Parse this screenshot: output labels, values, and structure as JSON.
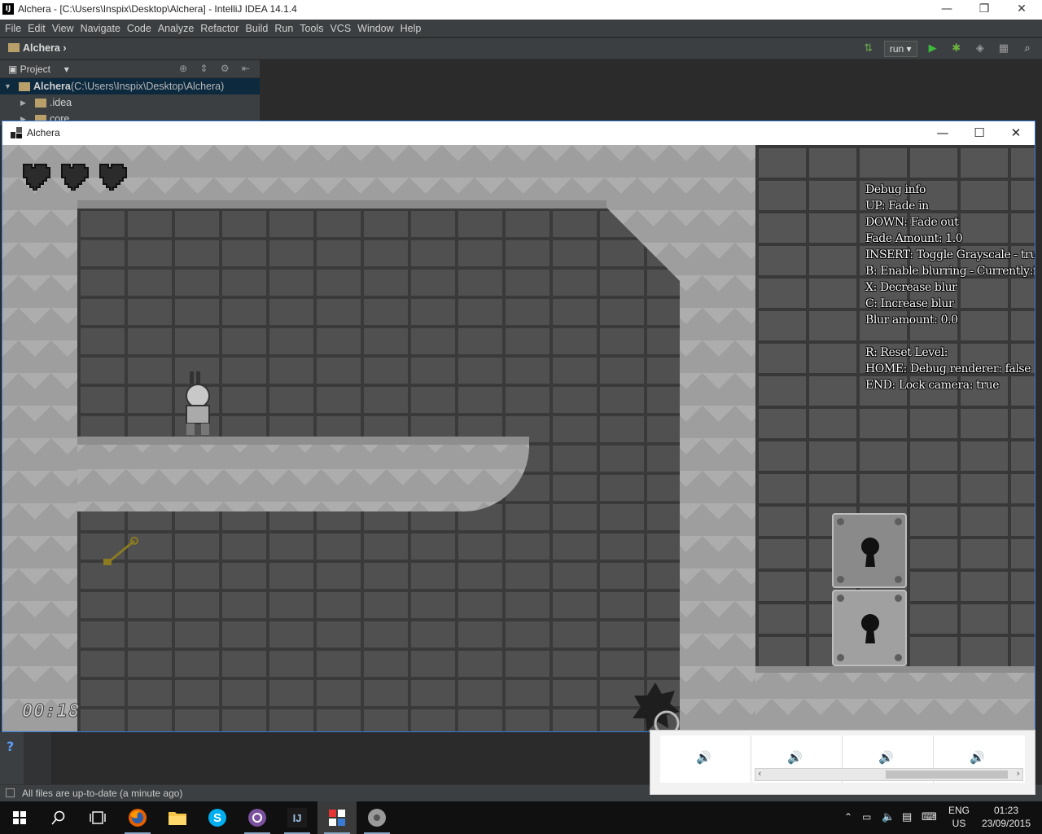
{
  "ide": {
    "window_title": "Alchera - [C:\\Users\\Inspix\\Desktop\\Alchera] - IntelliJ IDEA 14.1.4",
    "menu": [
      "File",
      "Edit",
      "View",
      "Navigate",
      "Code",
      "Analyze",
      "Refactor",
      "Build",
      "Run",
      "Tools",
      "VCS",
      "Window",
      "Help"
    ],
    "breadcrumb": "Alchera",
    "run_config": "run",
    "project_panel": {
      "tab_label": "Project",
      "root_name": "Alchera",
      "root_path": "(C:\\Users\\Inspix\\Desktop\\Alchera)",
      "children": [
        ".idea",
        "core"
      ]
    },
    "status_message": "All files are up-to-date (a minute ago)"
  },
  "game": {
    "window_title": "Alchera",
    "hearts_count": 3,
    "debug_lines": [
      "Debug info",
      "UP: Fade in",
      "DOWN: Fade out",
      "Fade Amount: 1.0",
      "INSERT: Toggle Grayscale - true",
      "B: Enable blurring - Currently:false",
      "X: Decrease blur",
      "C: Increase blur",
      "Blur amount: 0.0",
      "",
      "R: Reset Level:",
      "HOME: Debug renderer: false",
      "END: Lock camera: true"
    ],
    "timer": "00:18"
  },
  "taskbar": {
    "language_top": "ENG",
    "language_bottom": "US",
    "time": "01:23",
    "date": "23/09/2015"
  }
}
